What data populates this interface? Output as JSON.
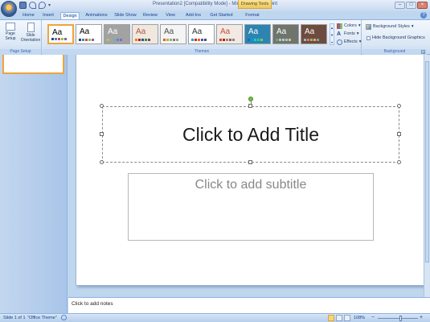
{
  "window": {
    "title": "Presentation2 [Compatibility Mode] - Microsoft PowerPoint",
    "contextual_tab_group": "Drawing Tools",
    "controls": [
      "–",
      "□",
      "×"
    ]
  },
  "quick_access": {
    "icons": [
      "save-icon",
      "undo-icon",
      "redo-icon",
      "customize-icon"
    ]
  },
  "tabs": [
    {
      "label": "Home"
    },
    {
      "label": "Insert"
    },
    {
      "label": "Design",
      "active": true
    },
    {
      "label": "Animations"
    },
    {
      "label": "Slide Show"
    },
    {
      "label": "Review"
    },
    {
      "label": "View"
    },
    {
      "label": "Add-Ins"
    },
    {
      "label": "Get Started"
    },
    {
      "label": "Format"
    }
  ],
  "ribbon": {
    "page_setup": {
      "group_label": "Page Setup",
      "page_setup_label": "Page Setup",
      "slide_orientation_label": "Slide Orientation"
    },
    "themes": {
      "group_label": "Themes",
      "sample_text": "Aa",
      "items": [
        {
          "name": "office-theme-selected",
          "bg": "#ffffff",
          "fg": "#000000"
        },
        {
          "name": "office-theme",
          "bg": "#ffffff",
          "fg": "#000000"
        },
        {
          "name": "apex",
          "bg": "#a2a2a2",
          "fg": "#ffffff"
        },
        {
          "name": "aspect",
          "bg": "#f0e7df",
          "fg": "#b2583f"
        },
        {
          "name": "civic",
          "bg": "#f4f4f4",
          "fg": "#4f4f4f"
        },
        {
          "name": "concourse",
          "bg": "#ffffff",
          "fg": "#333333"
        },
        {
          "name": "equity",
          "bg": "#f2e9e4",
          "fg": "#c2532c"
        },
        {
          "name": "flow",
          "bg": "#2e84b0",
          "fg": "#ffffff"
        },
        {
          "name": "foundry",
          "bg": "#6f756d",
          "fg": "#ffffff"
        },
        {
          "name": "median",
          "bg": "#6e4b3f",
          "fg": "#ffffff"
        }
      ],
      "colors_label": "Colors",
      "fonts_label": "Fonts",
      "effects_label": "Effects"
    },
    "background": {
      "group_label": "Background",
      "styles_label": "Background Styles",
      "hide_graphics_label": "Hide Background Graphics"
    }
  },
  "slide": {
    "title_placeholder": "Click to Add Title",
    "subtitle_placeholder": "Click to add subtitle"
  },
  "notes": {
    "placeholder": "Click to add notes"
  },
  "status": {
    "slide_info": "Slide 1 of 1",
    "theme": "\"Office Theme\"",
    "zoom": "108%"
  }
}
